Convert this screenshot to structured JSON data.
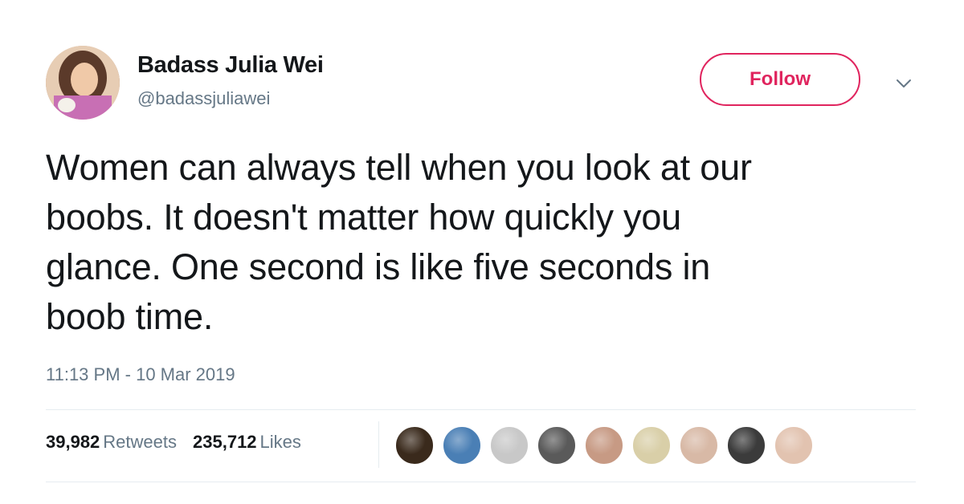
{
  "tweet": {
    "display_name": "Badass Julia Wei",
    "handle": "@badassjuliawei",
    "follow_label": "Follow",
    "text_lines": [
      "Women can always tell when you look at our",
      "boobs. It doesn't matter how quickly you",
      "glance. One second is like five seconds in",
      "boob time."
    ],
    "timestamp": "11:13 PM - 10 Mar 2019",
    "retweets_count": "39,982",
    "retweets_label": "Retweets",
    "likes_count": "235,712",
    "likes_label": "Likes"
  },
  "colors": {
    "follow_accent": "#e0245e",
    "secondary_text": "#657786",
    "primary_text": "#14171a",
    "divider": "#e6ecf0"
  },
  "icons": {
    "more": "chevron-down-icon"
  },
  "likers": [
    {
      "name": "liker-avatar-1",
      "color": "#3a2a1c"
    },
    {
      "name": "liker-avatar-2",
      "color": "#4a7fb5"
    },
    {
      "name": "liker-avatar-3",
      "color": "#c8c8c8"
    },
    {
      "name": "liker-avatar-4",
      "color": "#5a5a5a"
    },
    {
      "name": "liker-avatar-5",
      "color": "#c79a84"
    },
    {
      "name": "liker-avatar-6",
      "color": "#d9cfa8"
    },
    {
      "name": "liker-avatar-7",
      "color": "#d8b9a6"
    },
    {
      "name": "liker-avatar-8",
      "color": "#3b3b3b"
    },
    {
      "name": "liker-avatar-9",
      "color": "#e2c3b0"
    }
  ]
}
